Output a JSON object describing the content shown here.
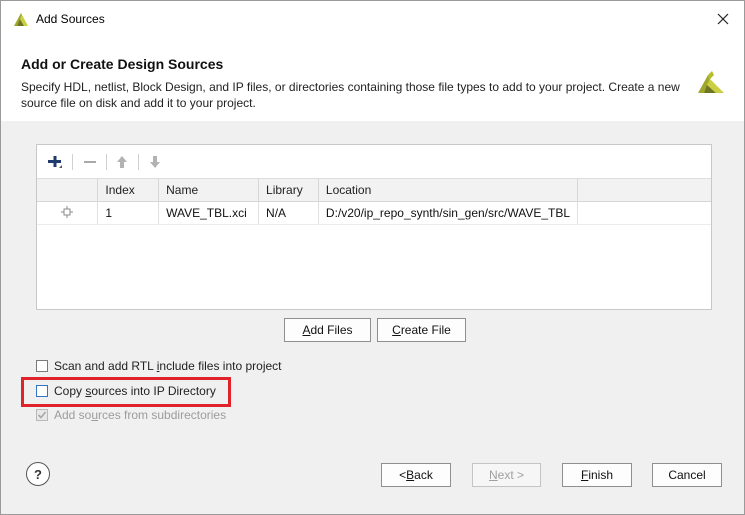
{
  "window": {
    "title": "Add Sources"
  },
  "header": {
    "title": "Add or Create Design Sources",
    "description": "Specify HDL, netlist, Block Design, and IP files, or directories containing those file types to add to your project. Create a new source file on disk and add it to your project."
  },
  "toolbar": {
    "add_icon": "plus-icon",
    "remove_icon": "minus-icon",
    "move_up_icon": "arrow-up-icon",
    "move_down_icon": "arrow-down-icon"
  },
  "table": {
    "columns": [
      "",
      "Index",
      "Name",
      "Library",
      "Location"
    ],
    "rows": [
      {
        "icon": "ip-icon",
        "index": "1",
        "name": "WAVE_TBL.xci",
        "library": "N/A",
        "location": "D:/v20/ip_repo_synth/sin_gen/src/WAVE_TBL"
      }
    ]
  },
  "buttons": {
    "add_files_pre": "",
    "add_files_hot": "A",
    "add_files_post": "dd Files",
    "create_file_pre": "",
    "create_file_hot": "C",
    "create_file_post": "reate File"
  },
  "options": {
    "scan_rtl_pre": "Scan and add RTL ",
    "scan_rtl_hot": "i",
    "scan_rtl_post": "nclude files into project",
    "copy_sources_pre": "Copy ",
    "copy_sources_hot": "s",
    "copy_sources_post": "ources into IP Directory",
    "add_subdirs_pre": "Add so",
    "add_subdirs_hot": "u",
    "add_subdirs_post": "rces from subdirectories"
  },
  "footer": {
    "help_label": "?",
    "back_pre": "< ",
    "back_hot": "B",
    "back_post": "ack",
    "next_hot": "N",
    "next_post": "ext >",
    "finish_hot": "F",
    "finish_post": "inish",
    "cancel_label": "Cancel"
  },
  "colors": {
    "highlight": "#e0232b",
    "brand": "#b5bd2a"
  }
}
